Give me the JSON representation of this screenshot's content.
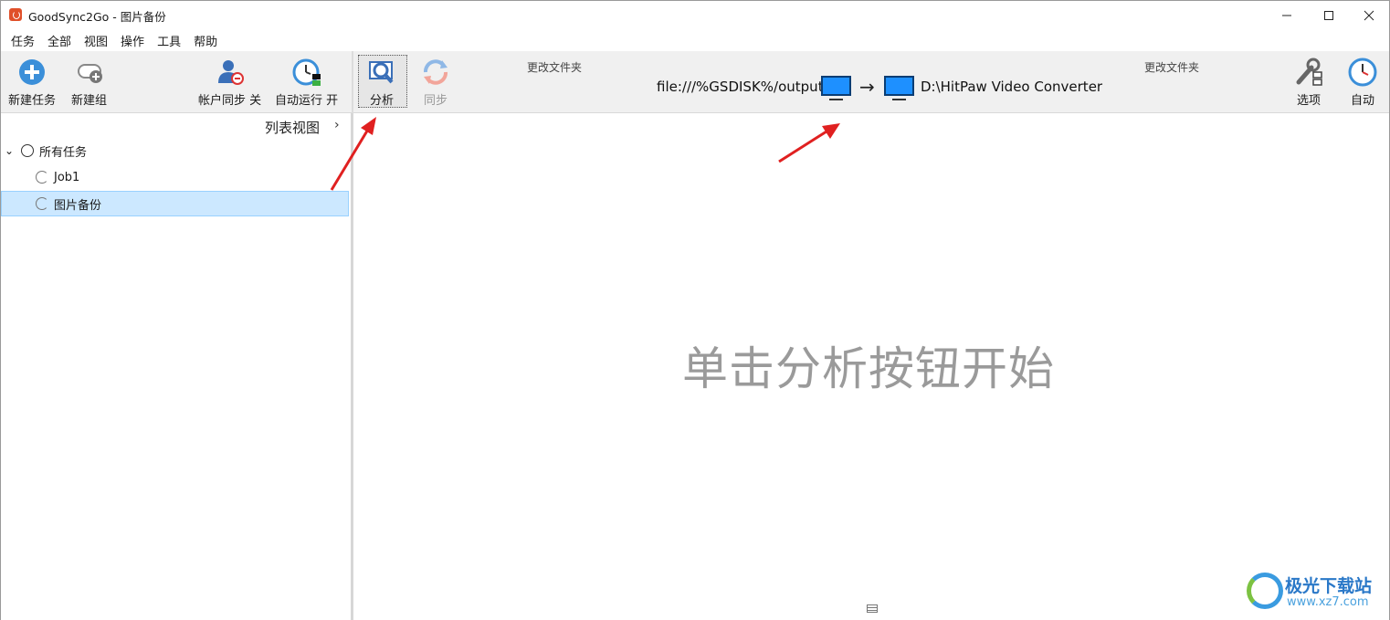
{
  "window": {
    "title": "GoodSync2Go - 图片备份",
    "controls": {
      "minimize": "–",
      "maximize": "☐",
      "close": "✕"
    }
  },
  "menu": [
    "任务",
    "全部",
    "视图",
    "操作",
    "工具",
    "帮助"
  ],
  "toolbar": {
    "new_job": "新建任务",
    "new_group": "新建组",
    "account_sync": "帐户同步 关",
    "auto_run": "自动运行 开",
    "analyze": "分析",
    "sync": "同步",
    "options": "选项",
    "auto": "自动"
  },
  "folders": {
    "left_change": "更改文件夹",
    "right_change": "更改文件夹",
    "left_path": "file:///%GSDISK%/output",
    "arrow": "→",
    "right_path": "D:\\HitPaw Video Converter"
  },
  "left_panel": {
    "list_view": "列表视图",
    "list_view_chevron": "›",
    "expander": "⌄",
    "tree": [
      {
        "label": "所有任务"
      },
      {
        "label": "Job1"
      },
      {
        "label": "图片备份",
        "selected": true
      }
    ]
  },
  "main": {
    "placeholder": "单击分析按钮开始"
  },
  "watermark": {
    "title": "极光下载站",
    "url": "www.xz7.com"
  },
  "colors": {
    "accent_blue": "#1e90ff",
    "selection_bg": "#cce8ff",
    "annotation_red": "#e02020"
  }
}
